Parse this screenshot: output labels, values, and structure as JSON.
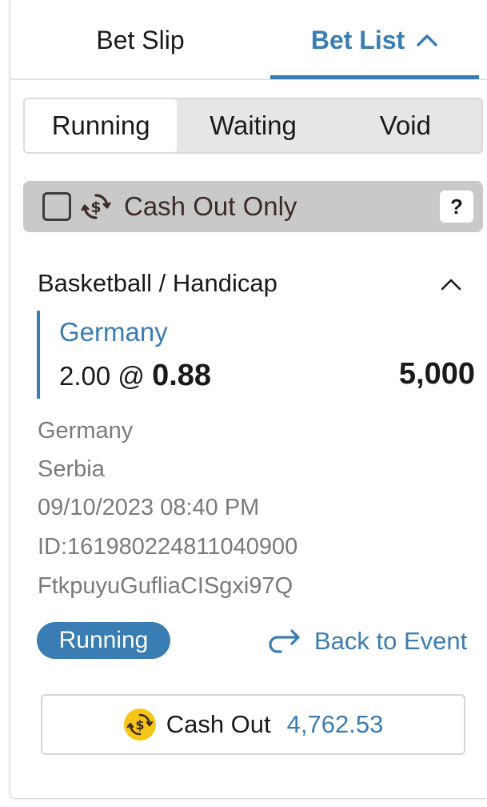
{
  "tabs": {
    "bet_slip": "Bet Slip",
    "bet_list": "Bet List"
  },
  "filters": [
    "Running",
    "Waiting",
    "Void"
  ],
  "cash_out_only": {
    "label": "Cash Out Only",
    "checked": false,
    "help": "?"
  },
  "bet": {
    "sport_market": "Basketball / Handicap",
    "selection": "Germany",
    "handicap": "2.00",
    "at": "@",
    "odds": "0.88",
    "stake": "5,000",
    "home_team": "Germany",
    "away_team": "Serbia",
    "datetime": "09/10/2023 08:40 PM",
    "id": "ID:161980224811040900",
    "code": "FtkpuyuGufliaCISgxi97Q",
    "status": "Running",
    "back_to_event": "Back to Event",
    "cash_out_label": "Cash Out",
    "cash_out_amount": "4,762.53"
  },
  "colors": {
    "accent": "#3a7db3",
    "coin": "#f5c518",
    "muted": "#7a7a7a",
    "bar": "#c9c9c9"
  },
  "icons": [
    "chevron-up-icon",
    "cash-out-icon",
    "help-icon",
    "back-arrow-icon",
    "coin-icon"
  ]
}
